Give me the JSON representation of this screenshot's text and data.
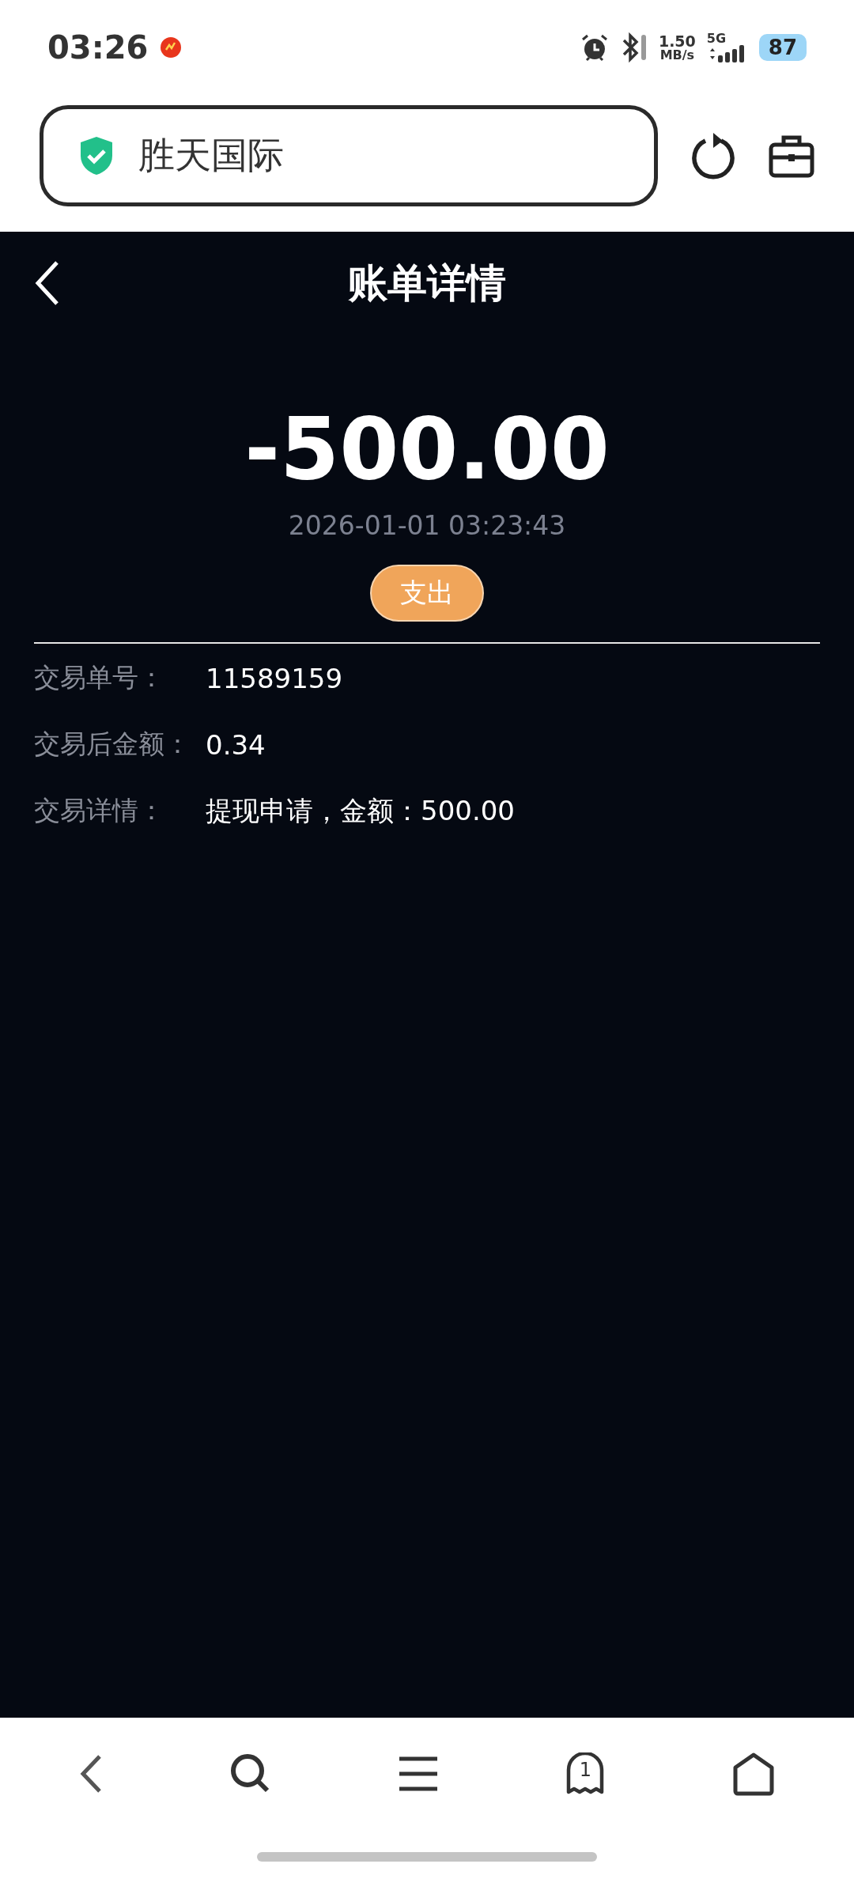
{
  "status_bar": {
    "time": "03:26",
    "speed_value": "1.50",
    "speed_unit": "MB/s",
    "network": "5G",
    "battery": "87"
  },
  "address_bar": {
    "title": "胜天国际"
  },
  "header": {
    "title": "账单详情"
  },
  "summary": {
    "amount": "-500.00",
    "datetime": "2026-01-01 03:23:43",
    "type_badge": "支出"
  },
  "details": [
    {
      "label": "交易单号：",
      "value": "11589159"
    },
    {
      "label": "交易后金额：",
      "value": "0.34"
    },
    {
      "label": "交易详情：",
      "value": "提现申请，金额：500.00"
    }
  ],
  "bottom_nav": {
    "tab_count": "1"
  }
}
